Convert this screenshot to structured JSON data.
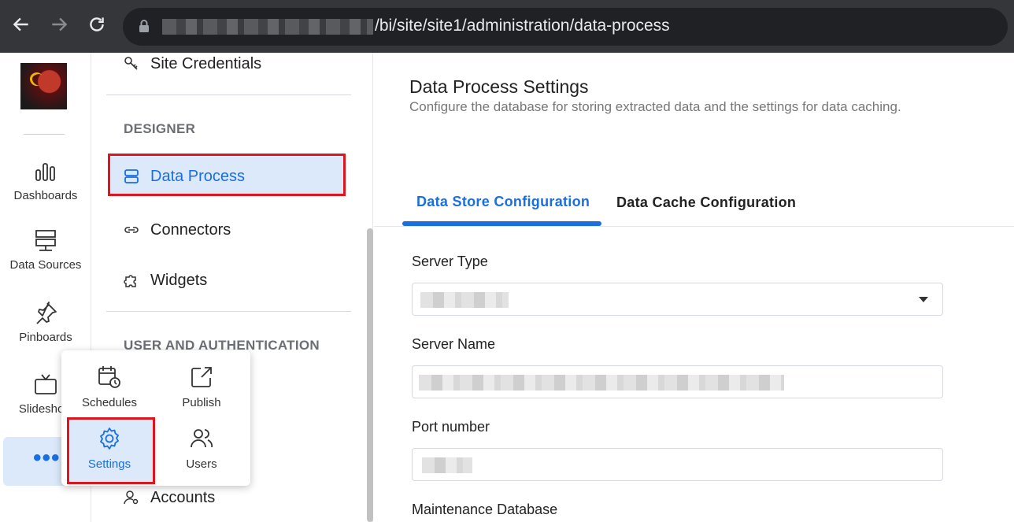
{
  "browser": {
    "url_path": "/bi/site/site1/administration/data-process"
  },
  "rail": {
    "items": [
      {
        "label": "Dashboards",
        "icon": "bar-chart-icon"
      },
      {
        "label": "Data Sources",
        "icon": "server-icon"
      },
      {
        "label": "Pinboards",
        "icon": "pin-icon"
      },
      {
        "label": "Slideshow",
        "icon": "tv-icon"
      }
    ],
    "more_label": "•••"
  },
  "midnav": {
    "site_credentials": "Site Credentials",
    "designer_heading": "DESIGNER",
    "data_process": "Data Process",
    "connectors": "Connectors",
    "widgets": "Widgets",
    "user_auth_heading": "USER AND AUTHENTICATION",
    "accounts": "Accounts"
  },
  "popup": {
    "schedules": "Schedules",
    "publish": "Publish",
    "settings": "Settings",
    "users": "Users"
  },
  "main": {
    "title": "Data Process Settings",
    "subtitle": "Configure the database for storing extracted data and the settings for data caching.",
    "tabs": [
      {
        "label": "Data Store Configuration",
        "active": true
      },
      {
        "label": "Data Cache Configuration",
        "active": false
      }
    ],
    "fields": {
      "server_type_label": "Server Type",
      "server_name_label": "Server Name",
      "port_label": "Port number",
      "maintenance_label": "Maintenance Database"
    }
  },
  "colors": {
    "accent": "#1a6fe0",
    "highlight": "#e0141c",
    "active_bg": "#dbe9fb"
  }
}
